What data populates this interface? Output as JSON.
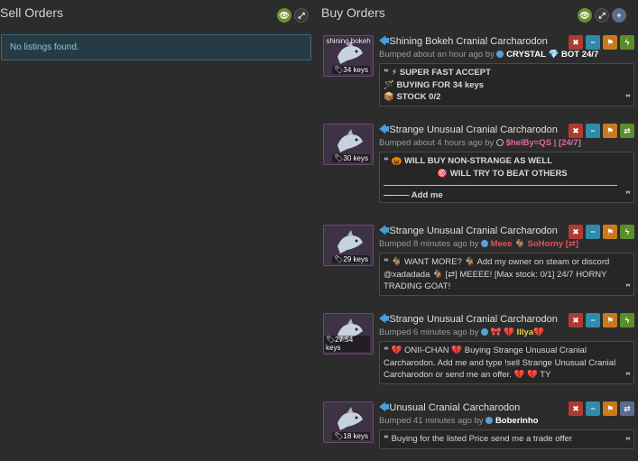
{
  "sell": {
    "title": "Sell Orders",
    "empty": "No listings found."
  },
  "buy": {
    "title": "Buy Orders",
    "orders": [
      {
        "item": "Shining Bokeh Cranial Carcharodon",
        "thumb_caption": "shining bokeh",
        "price": "34 keys",
        "bumped": "Bumped about an hour ago by",
        "user": "CRYSTAL",
        "user_suffix": "BOT 24/7",
        "lines": [
          "⚡ SUPER FAST ACCEPT",
          "🪄 BUYING FOR 34 keys",
          "📦 STOCK 0/2"
        ]
      },
      {
        "item": "Strange Unusual Cranial Carcharodon",
        "price": "30 keys",
        "bumped": "Bumped about 4 hours ago by",
        "user": "$helBy=QS | [24/7]",
        "lines": [
          "🎃 WILL BUY NON-STRANGE AS WELL",
          "🎯 WILL TRY TO BEAT OTHERS",
          "——— Add me"
        ]
      },
      {
        "item": "Strange Unusual Cranial Carcharodon",
        "price": "29 keys",
        "bumped": "Bumped 8 minutes ago by",
        "user": "Meee",
        "user_suffix": "SoHorny [⇄]",
        "text": "🐐 WANT MORE? 🐐 Add my owner on steam or discord @xadadada 🐐 [⇄] MEEEE! [Max stock: 0/1] 24/7 HORNY TRADING GOAT!"
      },
      {
        "item": "Strange Unusual Cranial Carcharodon",
        "price": "27.54 keys",
        "bumped": "Bumped 6 minutes ago by",
        "user": "Illya",
        "text": "💔 ONII-CHAN 💔 Buying Strange Unusual Cranial Carcharodon. Add me and type !sell Strange Unusual Cranial Carcharodon or send me an offer. 💔 💔 TY"
      },
      {
        "item": "Unusual Cranial Carcharodon",
        "price": "18 keys",
        "bumped": "Bumped 41 minutes ago by",
        "user": "Boberinho",
        "text": "Buying for the listed Price send me a trade offer"
      }
    ]
  },
  "colors": {
    "background": "#2c2c2c",
    "info_box": "#273b44",
    "info_text": "#88c7dc",
    "link_arrow": "#4a9fd5",
    "remove": "#b03a32",
    "minus": "#2f8bab",
    "flag": "#c97b1c",
    "bolt": "#5c8d2a",
    "swap": "#5a6d8a"
  },
  "icons": {
    "header": [
      "eye-icon",
      "expand-icon",
      "plus-icon"
    ],
    "actions": [
      "close-icon",
      "minus-icon",
      "flag-icon",
      "lightning-icon",
      "swap-icon"
    ],
    "quote": "quote-icon",
    "price": "tag-icon"
  }
}
